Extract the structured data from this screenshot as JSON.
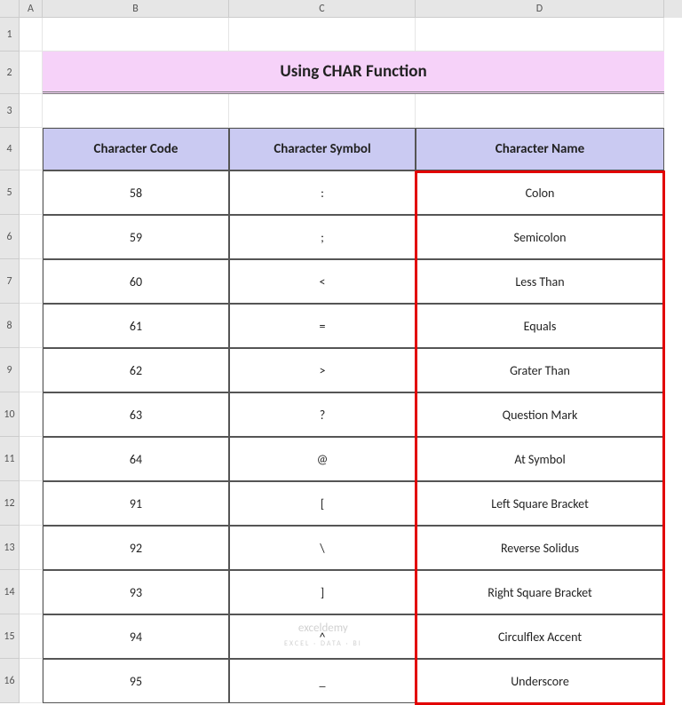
{
  "columns": {
    "a": "A",
    "b": "B",
    "c": "C",
    "d": "D"
  },
  "rowNums": [
    "1",
    "2",
    "3",
    "4",
    "5",
    "6",
    "7",
    "8",
    "9",
    "10",
    "11",
    "12",
    "13",
    "14",
    "15",
    "16"
  ],
  "title": "Using CHAR Function",
  "headers": {
    "code": "Character Code",
    "symbol": "Character Symbol",
    "name": "Character Name"
  },
  "rows": [
    {
      "code": "58",
      "symbol": ":",
      "name": "Colon"
    },
    {
      "code": "59",
      "symbol": ";",
      "name": "Semicolon"
    },
    {
      "code": "60",
      "symbol": "<",
      "name": "Less Than"
    },
    {
      "code": "61",
      "symbol": "=",
      "name": "Equals"
    },
    {
      "code": "62",
      "symbol": ">",
      "name": "Grater Than"
    },
    {
      "code": "63",
      "symbol": "?",
      "name": "Question Mark"
    },
    {
      "code": "64",
      "symbol": "@",
      "name": "At Symbol"
    },
    {
      "code": "91",
      "symbol": "[",
      "name": "Left Square Bracket"
    },
    {
      "code": "92",
      "symbol": "\\",
      "name": "Reverse Solidus"
    },
    {
      "code": "93",
      "symbol": "]",
      "name": "Right Square Bracket"
    },
    {
      "code": "94",
      "symbol": "^",
      "name": "Circulflex Accent"
    },
    {
      "code": "95",
      "symbol": "_",
      "name": "Underscore"
    }
  ],
  "watermark": {
    "main": "exceldemy",
    "sub": "EXCEL · DATA · BI"
  }
}
